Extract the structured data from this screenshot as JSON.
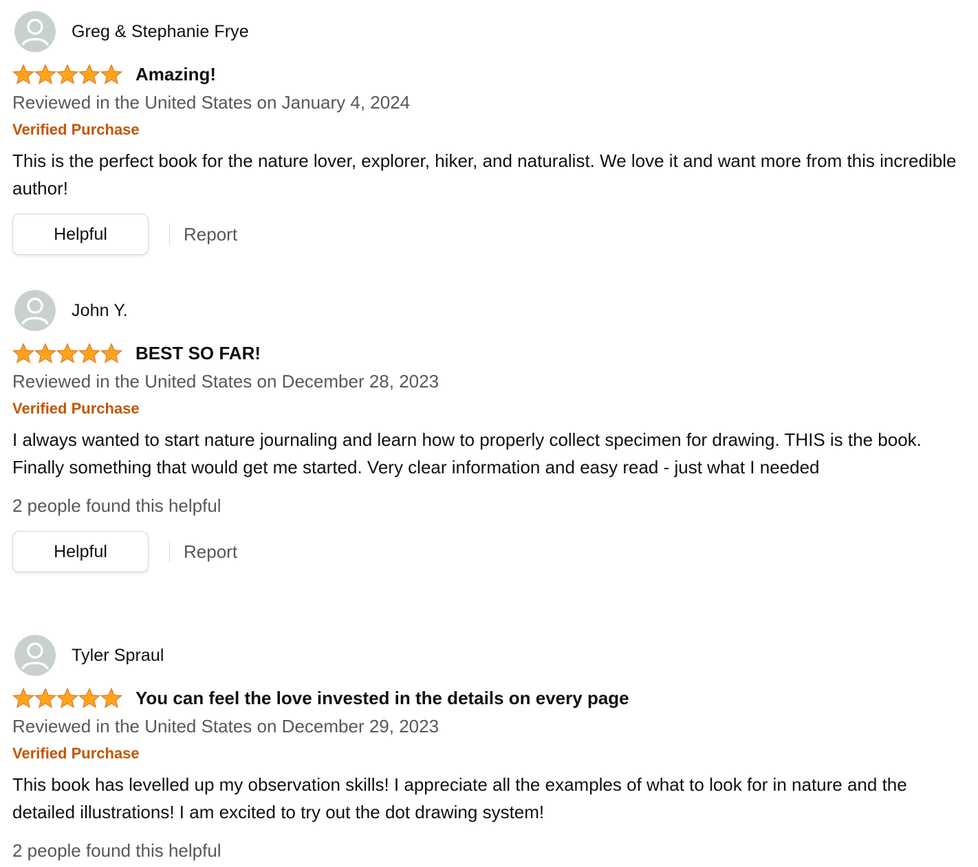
{
  "colors": {
    "star_fill": "#ffa41c",
    "star_stroke": "#de7921",
    "verified": "#c45500",
    "secondary_text": "#565959",
    "avatar_bg": "#c8d0d0",
    "avatar_fg": "#ffffff"
  },
  "reviews": [
    {
      "profile_name": "Greg & Stephanie Frye",
      "rating": 5,
      "title": "Amazing!",
      "date": "Reviewed in the United States on January 4, 2024",
      "verified": "Verified Purchase",
      "body": "This is the perfect book for the nature lover, explorer, hiker, and naturalist. We love it and want more from this incredible author!",
      "helpful_count": "",
      "helpful_label": "Helpful",
      "report_label": "Report"
    },
    {
      "profile_name": "John Y.",
      "rating": 5,
      "title": "BEST SO FAR!",
      "date": "Reviewed in the United States on December 28, 2023",
      "verified": "Verified Purchase",
      "body": "I always wanted to start nature journaling and learn how to properly collect specimen for drawing. THIS is the book. Finally something that would get me started. Very clear information and easy read - just what I needed",
      "helpful_count": "2 people found this helpful",
      "helpful_label": "Helpful",
      "report_label": "Report"
    },
    {
      "profile_name": "Tyler Spraul",
      "rating": 5,
      "title": "You can feel the love invested in the details on every page",
      "date": "Reviewed in the United States on December 29, 2023",
      "verified": "Verified Purchase",
      "body": "This book has levelled up my observation skills! I appreciate all the examples of what to look for in nature and the detailed illustrations! I am excited to try out the dot drawing system!",
      "helpful_count": "2 people found this helpful"
    }
  ]
}
